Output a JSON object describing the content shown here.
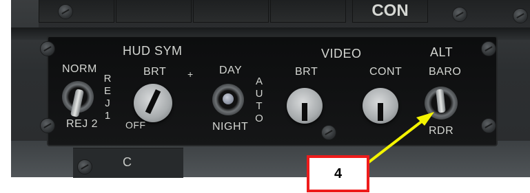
{
  "upper_panel": {
    "button_label": "CON"
  },
  "panel": {
    "hud_sym_title": "HUD SYM",
    "video_title": "VIDEO",
    "alt_title": "ALT",
    "rej_switch": {
      "top_label": "NORM",
      "bottom_label": "REJ 2",
      "side_label": "REJ1"
    },
    "hud_brt_knob": {
      "top_label": "BRT",
      "plus_label": "+",
      "bottom_label": "OFF"
    },
    "day_night_switch": {
      "top_label": "DAY",
      "bottom_label": "NIGHT",
      "side_label": "AUTO"
    },
    "video_brt_knob": {
      "label": "BRT"
    },
    "video_cont_knob": {
      "label": "CONT"
    },
    "alt_switch": {
      "top_label": "BARO",
      "bottom_label": "RDR"
    }
  },
  "lower_panel": {
    "partial_label": "C"
  },
  "callout": {
    "number": "4",
    "box_color": "#ee1c1c",
    "arrow_color": "#f4f400"
  }
}
